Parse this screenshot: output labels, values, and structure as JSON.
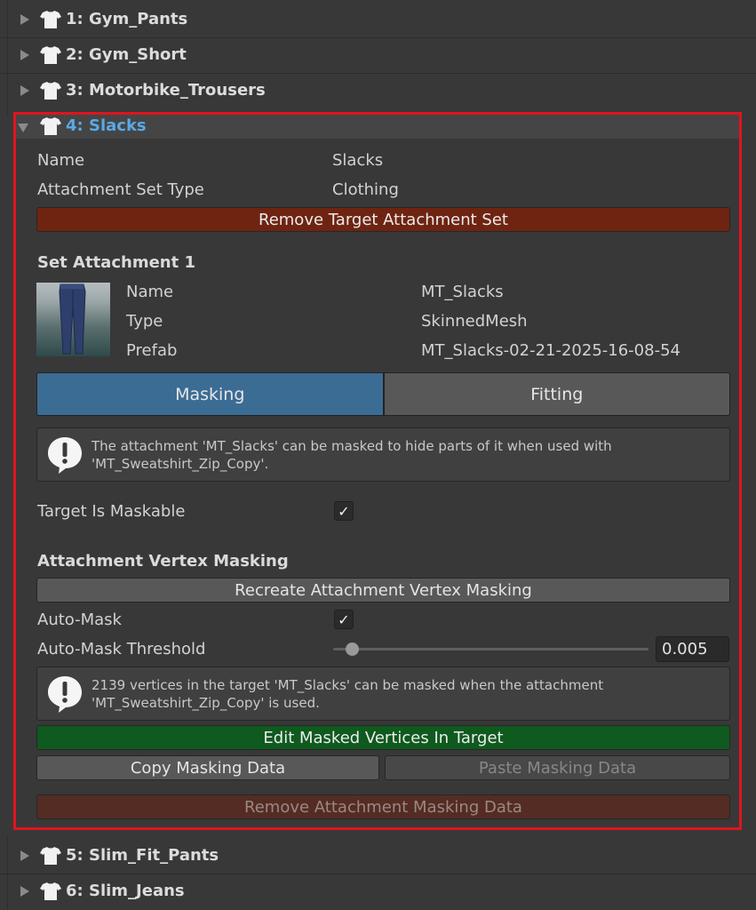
{
  "tree_items": [
    {
      "label": "1: Gym_Pants"
    },
    {
      "label": "2: Gym_Short"
    },
    {
      "label": "3: Motorbike_Trousers"
    },
    {
      "label": "4: Slacks"
    },
    {
      "label": "5: Slim_Fit_Pants"
    },
    {
      "label": "6: Slim_Jeans"
    }
  ],
  "details": {
    "name_label": "Name",
    "name_value": "Slacks",
    "type_label": "Attachment Set Type",
    "type_value": "Clothing",
    "remove_set_button": "Remove Target Attachment Set"
  },
  "set_attachment": {
    "heading": "Set Attachment 1",
    "name_label": "Name",
    "name_value": "MT_Slacks",
    "type_label": "Type",
    "type_value": "SkinnedMesh",
    "prefab_label": "Prefab",
    "prefab_value": "MT_Slacks-02-21-2025-16-08-54"
  },
  "tabs": [
    {
      "label": "Masking",
      "active": true
    },
    {
      "label": "Fitting",
      "active": false
    }
  ],
  "help1": "The attachment 'MT_Slacks' can be masked to hide parts of it when used with 'MT_Sweatshirt_Zip_Copy'.",
  "target_maskable": {
    "label": "Target Is Maskable",
    "checked": true,
    "mark": "✓"
  },
  "vertex_masking": {
    "heading": "Attachment Vertex Masking",
    "recreate_button": "Recreate Attachment Vertex Masking",
    "auto_mask_label": "Auto-Mask",
    "auto_mask_checked": true,
    "auto_mask_mark": "✓",
    "threshold_label": "Auto-Mask Threshold",
    "threshold_value": "0.005",
    "help2": "2139 vertices in the target 'MT_Slacks' can be masked when the attachment 'MT_Sweatshirt_Zip_Copy' is used.",
    "edit_button": "Edit Masked Vertices In Target",
    "copy_button": "Copy Masking Data",
    "paste_button": "Paste Masking Data",
    "remove_button": "Remove Attachment Masking Data"
  },
  "colors": {
    "background": "#383838",
    "selected_label": "#5aa9e6",
    "highlight_border": "#e0141e",
    "active_tab": "#3b6c94",
    "danger_button": "#6e2411",
    "success_button": "#0f5a1e"
  },
  "icons": [
    "tshirt-icon",
    "expand-arrow-icon",
    "collapse-arrow-icon",
    "info-icon",
    "checkmark-icon"
  ]
}
